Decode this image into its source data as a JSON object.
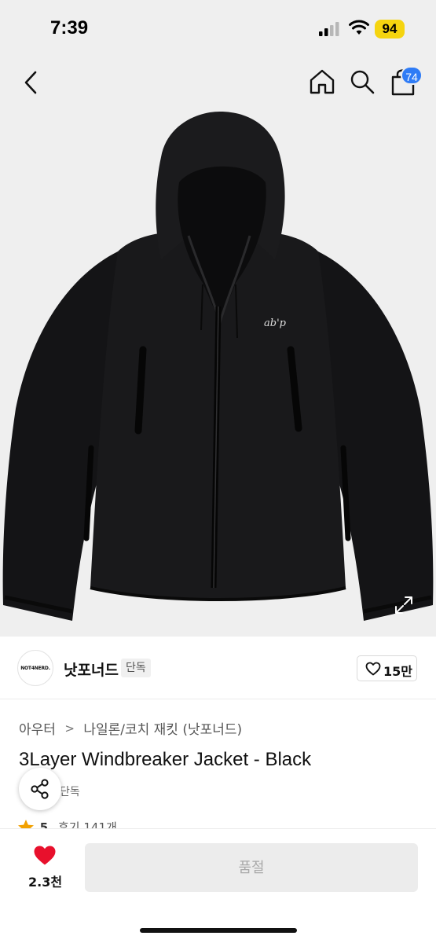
{
  "status_bar": {
    "time": "7:39",
    "battery": "94",
    "icons": [
      "signal-icon",
      "wifi-icon"
    ]
  },
  "nav": {
    "icons": [
      "back-chevron-icon",
      "home-icon",
      "search-icon",
      "cart-icon"
    ],
    "cart_count": "74"
  },
  "product_image": {
    "logo_text": "ab'p",
    "icons": [
      "expand-icon"
    ]
  },
  "brand": {
    "logo_text": "NOT4NERD.",
    "name": "낫포너드",
    "badge": "단독",
    "like_count": "15만",
    "icons": [
      "heart-outline-icon"
    ]
  },
  "product": {
    "breadcrumb": [
      "아우터",
      "나일론/코치 재킷 (낫포너드)"
    ],
    "breadcrumb_separator": ">",
    "title": "3Layer Windbreaker Jacket - Black",
    "sub_badge": "단독",
    "rating": "5",
    "reviews": "후기 141개",
    "icons": [
      "share-icon",
      "star-icon"
    ]
  },
  "bottom_bar": {
    "wish_count": "2.3천",
    "soldout_label": "품절",
    "icons": [
      "heart-filled-icon"
    ]
  },
  "colors": {
    "accent_blue": "#2f7cf6",
    "battery_yellow": "#f5d40f",
    "heart_red": "#e8102c",
    "star_orange": "#f2a100",
    "photo_bg": "#efefef"
  }
}
